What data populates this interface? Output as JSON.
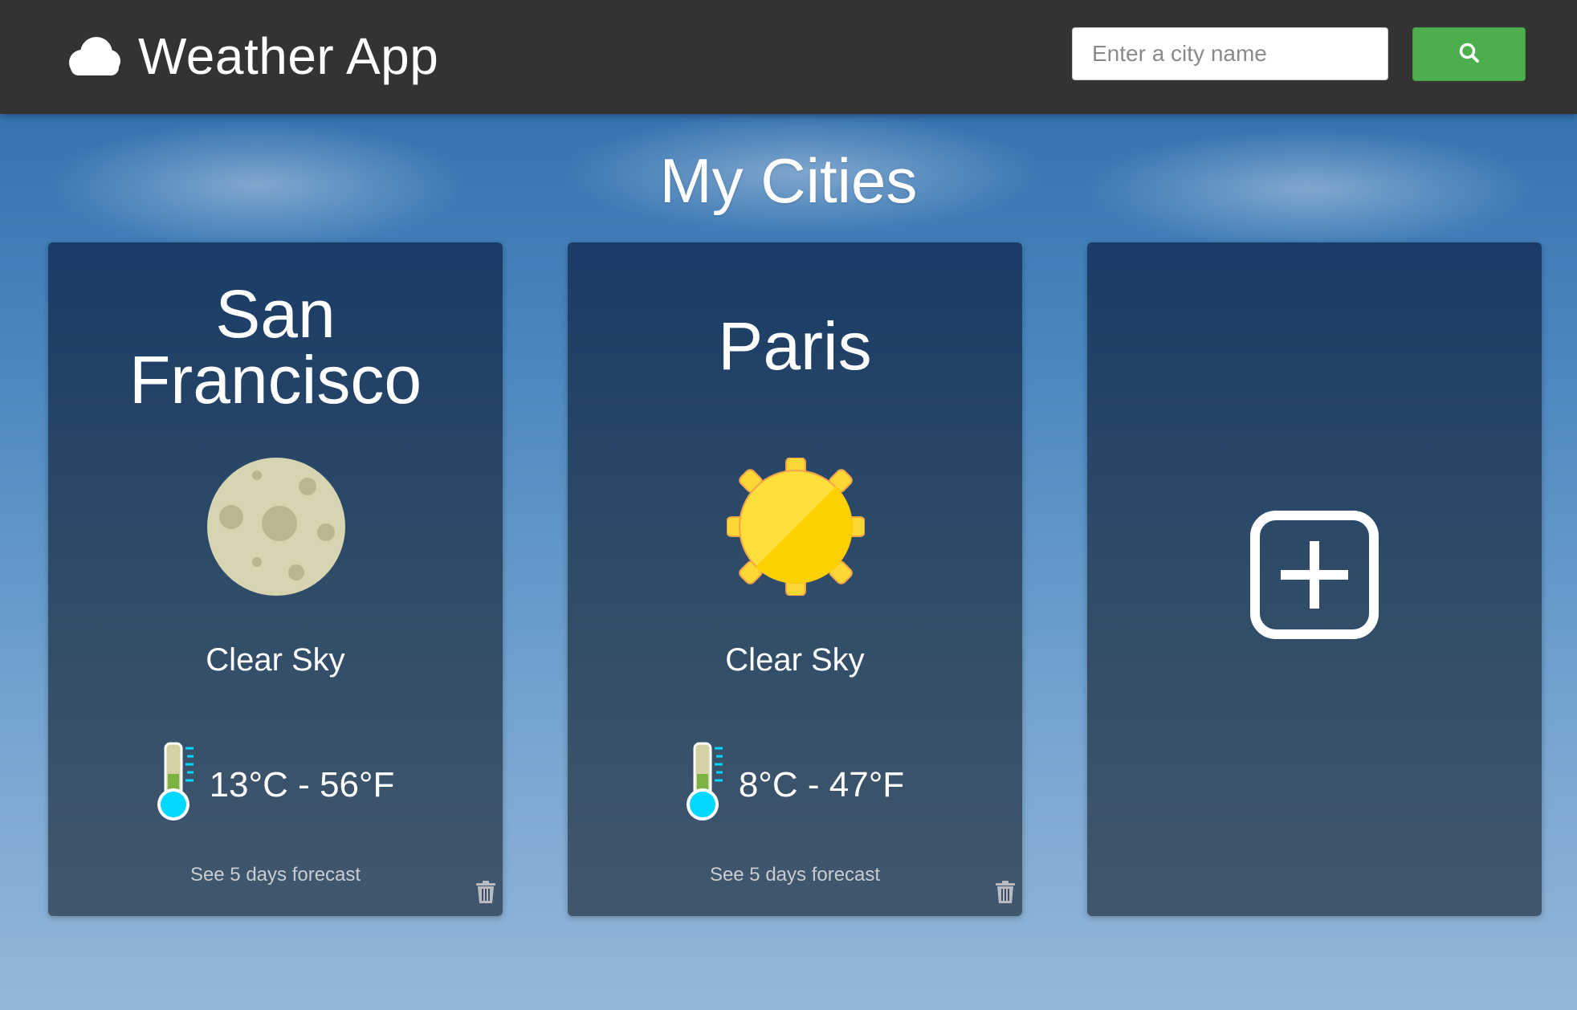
{
  "header": {
    "app_title": "Weather App",
    "app_icon": "cloud-icon",
    "search": {
      "placeholder": "Enter a city name",
      "value": ""
    },
    "search_button_icon": "search-icon"
  },
  "main": {
    "title": "My Cities",
    "cities": [
      {
        "name": "San Francisco",
        "condition": "Clear Sky",
        "icon": "moon-icon",
        "temperature": "13°C - 56°F",
        "forecast_link": "See 5 days forecast"
      },
      {
        "name": "Paris",
        "condition": "Clear Sky",
        "icon": "sun-icon",
        "temperature": "8°C - 47°F",
        "forecast_link": "See 5 days forecast"
      }
    ],
    "add_card_icon": "add-icon"
  },
  "colors": {
    "header_bg": "#333333",
    "search_button": "#4cae4c",
    "card_bg": "#2c4660",
    "sun": "#fdd835",
    "moon": "#d6d6b0",
    "thermometer_bulb": "#00d8ff"
  }
}
